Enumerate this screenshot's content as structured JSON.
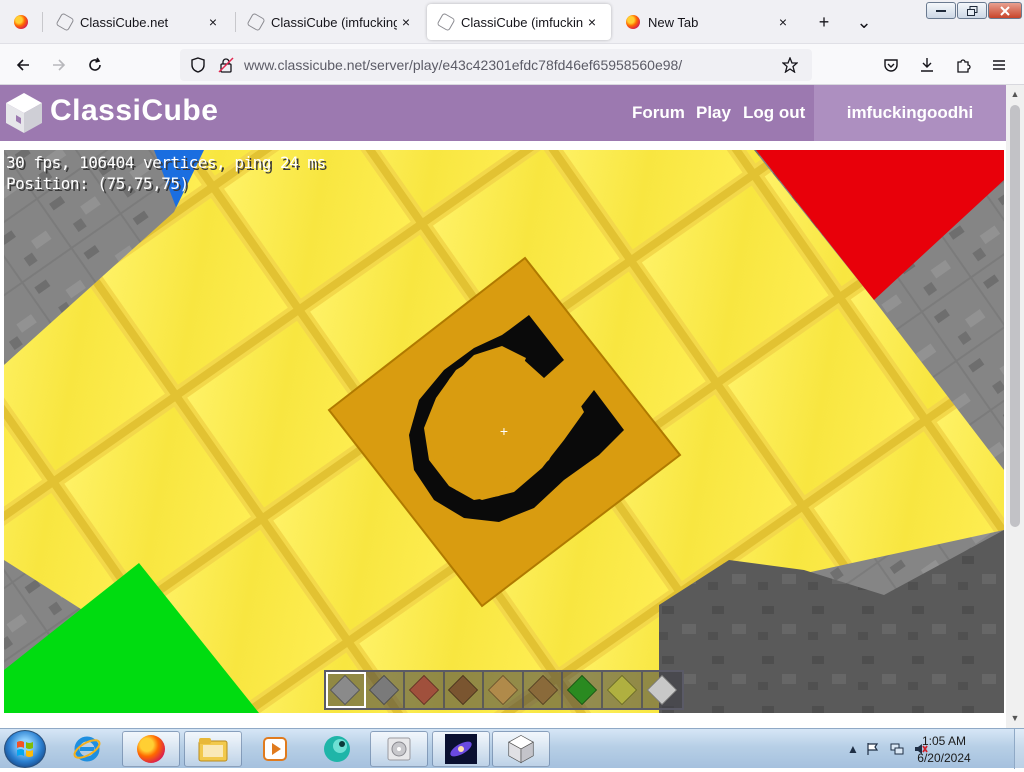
{
  "browser": {
    "tabs": [
      {
        "label": "ClassiCube.net",
        "favicon": "classicube-icon",
        "active": false
      },
      {
        "label": "ClassiCube (imfuckingoc",
        "favicon": "classicube-icon",
        "active": false
      },
      {
        "label": "ClassiCube (imfuckingoc",
        "favicon": "classicube-icon",
        "active": true
      },
      {
        "label": "New Tab",
        "favicon": "firefox-icon",
        "active": false
      }
    ],
    "close_glyph": "×",
    "new_tab_glyph": "+",
    "list_tabs_glyph": "⌄",
    "url": "www.classicube.net/server/play/e43c42301efdc78fd46ef65958560e98/"
  },
  "site": {
    "name": "ClassiCube",
    "nav": [
      "Forum",
      "Play",
      "Log out"
    ],
    "username": "imfuckingoodhi",
    "header_color": "#9c79b0"
  },
  "game": {
    "stats": "30 fps, 106404 vertices, ping 24 ms",
    "position": "Position: (75,75,75)",
    "crosshair": "+",
    "hotbar": [
      {
        "block": "stone",
        "color": "#8a8a8a",
        "selected": true
      },
      {
        "block": "cobblestone",
        "color": "#7a7a7a",
        "selected": false
      },
      {
        "block": "brick",
        "color": "#a0503c",
        "selected": false
      },
      {
        "block": "dirt",
        "color": "#7a5530",
        "selected": false
      },
      {
        "block": "wood-planks",
        "color": "#b08a4a",
        "selected": false
      },
      {
        "block": "log",
        "color": "#8a6a3a",
        "selected": false
      },
      {
        "block": "leaves",
        "color": "#2a8a20",
        "selected": false
      },
      {
        "block": "sponge",
        "color": "#b0b040",
        "selected": false
      },
      {
        "block": "slab",
        "color": "#c8c8c8",
        "selected": false
      }
    ]
  },
  "taskbar": {
    "apps": [
      "internet-explorer-icon",
      "firefox-icon",
      "file-explorer-icon",
      "media-player-icon",
      "app-icon",
      "disc-icon",
      "galaxy-icon",
      "classicube-icon"
    ],
    "time": "1:05 AM",
    "date": "6/20/2024"
  }
}
